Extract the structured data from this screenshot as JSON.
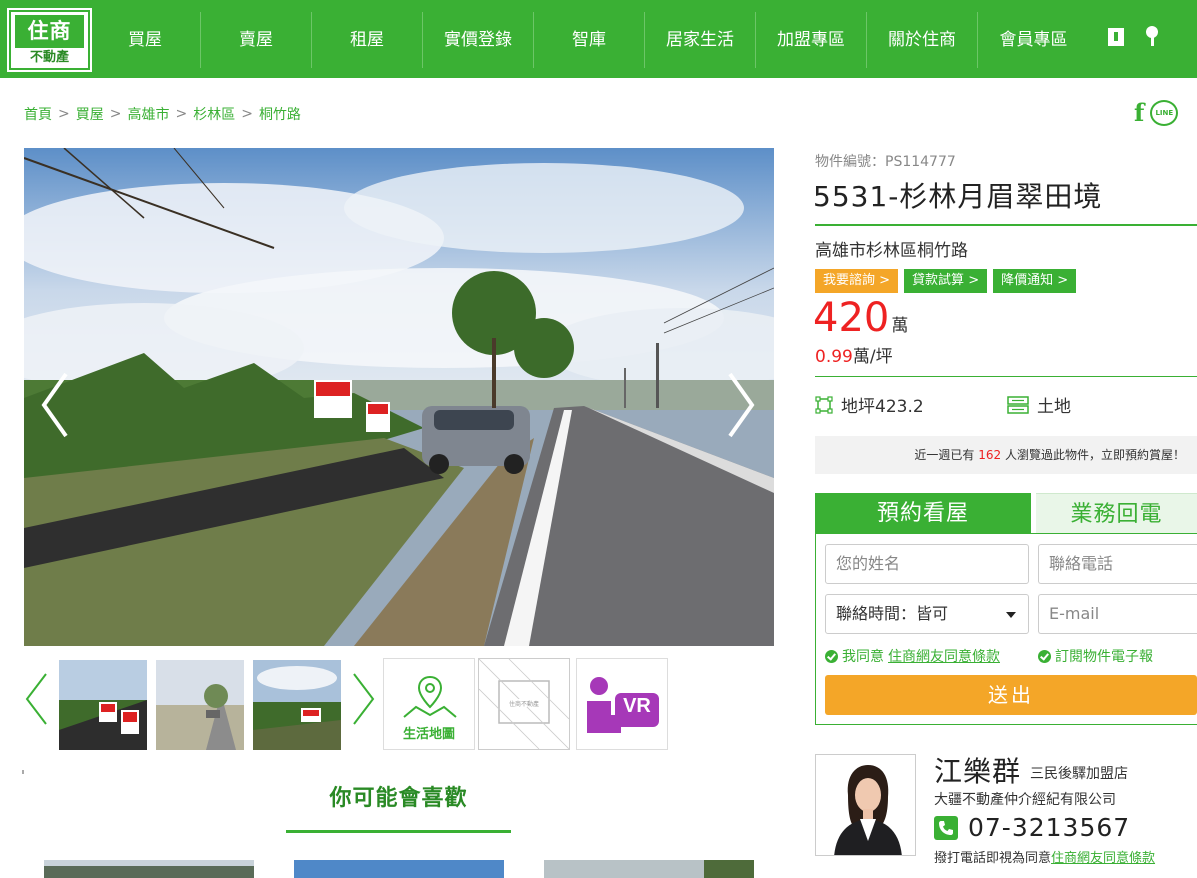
{
  "header": {
    "logo_top": "住商",
    "logo_bottom": "不動產",
    "menu": [
      "買屋",
      "賣屋",
      "租屋",
      "實價登錄",
      "智庫",
      "居家生活",
      "加盟專區",
      "關於住商",
      "會員專區"
    ]
  },
  "breadcrumb": [
    "首頁",
    "買屋",
    "高雄市",
    "杉林區",
    "桐竹路"
  ],
  "social": {
    "facebook": "f",
    "line": "LINE"
  },
  "listing": {
    "id_label": "物件編號：PS114777",
    "title": "5531-杉林月眉翠田境",
    "address": "高雄市杉林區桐竹路",
    "tags": [
      "我要諮詢",
      "貸款試算",
      "降價通知"
    ],
    "price": "420",
    "price_unit": "萬",
    "unit_price": "0.99",
    "unit_price_unit": "萬/坪",
    "land_area": "地坪423.2",
    "type": "土地",
    "notice_pre": "近一週已有",
    "notice_count": "162",
    "notice_post": "人瀏覽過此物件，立即預約賞屋！"
  },
  "thumbs": {
    "map_label": "生活地圖",
    "vr_label": "VR"
  },
  "recommend_title": "你可能會喜歡",
  "form": {
    "tab_active": "預約看屋",
    "tab_inactive": "業務回電",
    "name_placeholder": "您的姓名",
    "phone_placeholder": "聯絡電話",
    "time_select": "聯絡時間：皆可",
    "email_placeholder": "E-mail",
    "agree_pre": "我同意",
    "agree_link": "住商網友同意條款",
    "subscribe": "訂閱物件電子報",
    "submit": "送出"
  },
  "agent": {
    "name": "江樂群",
    "store": "三民後驛加盟店",
    "company": "大疆不動產仲介經紀有限公司",
    "phone": "07-3213567",
    "note_pre": "撥打電話即視為同意",
    "note_link": "住商網友同意條款"
  },
  "colors": {
    "brand": "#3ab034",
    "accent": "#f4a628",
    "price": "#e22222"
  }
}
